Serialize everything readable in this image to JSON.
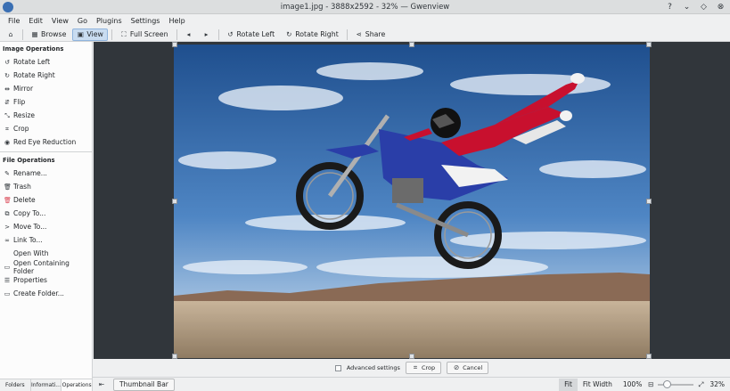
{
  "window": {
    "title": "image1.jpg - 3888x2592 - 32% — Gwenview",
    "icons": [
      "gwenview-app-icon",
      "help-icon",
      "minimize-icon",
      "maximize-icon",
      "close-icon"
    ]
  },
  "menubar": [
    "File",
    "Edit",
    "View",
    "Go",
    "Plugins",
    "Settings",
    "Help"
  ],
  "toolbar": {
    "browse": "Browse",
    "view": "View",
    "full_screen": "Full Screen",
    "rotate_left": "Rotate Left",
    "rotate_right": "Rotate Right",
    "share": "Share"
  },
  "sidebar": {
    "image_ops_title": "Image Operations",
    "image_ops": [
      {
        "label": "Rotate Left",
        "icon": "rotate-left-icon"
      },
      {
        "label": "Rotate Right",
        "icon": "rotate-right-icon"
      },
      {
        "label": "Mirror",
        "icon": "mirror-icon"
      },
      {
        "label": "Flip",
        "icon": "flip-icon"
      },
      {
        "label": "Resize",
        "icon": "resize-icon"
      },
      {
        "label": "Crop",
        "icon": "crop-icon"
      },
      {
        "label": "Red Eye Reduction",
        "icon": "red-eye-icon"
      }
    ],
    "file_ops_title": "File Operations",
    "file_ops": [
      {
        "label": "Rename...",
        "icon": "rename-icon"
      },
      {
        "label": "Trash",
        "icon": "trash-icon"
      },
      {
        "label": "Delete",
        "icon": "delete-icon"
      },
      {
        "label": "Copy To...",
        "icon": "copy-icon"
      },
      {
        "label": "Move To...",
        "icon": "move-icon"
      },
      {
        "label": "Link To...",
        "icon": "link-icon"
      },
      {
        "label": "Open With",
        "icon": ""
      },
      {
        "label": "Open Containing Folder",
        "icon": "folder-open-icon"
      },
      {
        "label": "Properties",
        "icon": "properties-icon"
      },
      {
        "label": "Create Folder...",
        "icon": "folder-new-icon"
      }
    ],
    "tabs": [
      "Folders",
      "Informati...",
      "Operations"
    ]
  },
  "cropbar": {
    "advanced_settings": "Advanced settings",
    "crop": "Crop",
    "cancel": "Cancel"
  },
  "statusbar": {
    "thumbnail_bar": "Thumbnail Bar",
    "fit": "Fit",
    "fit_width": "Fit Width",
    "zoom_100": "100%",
    "zoom_level": "32%",
    "zoom_slider_fraction": 0.32
  },
  "colors": {
    "accent": "#3daee9",
    "window_bg": "#eff0f1",
    "viewer_bg": "#31363b"
  }
}
